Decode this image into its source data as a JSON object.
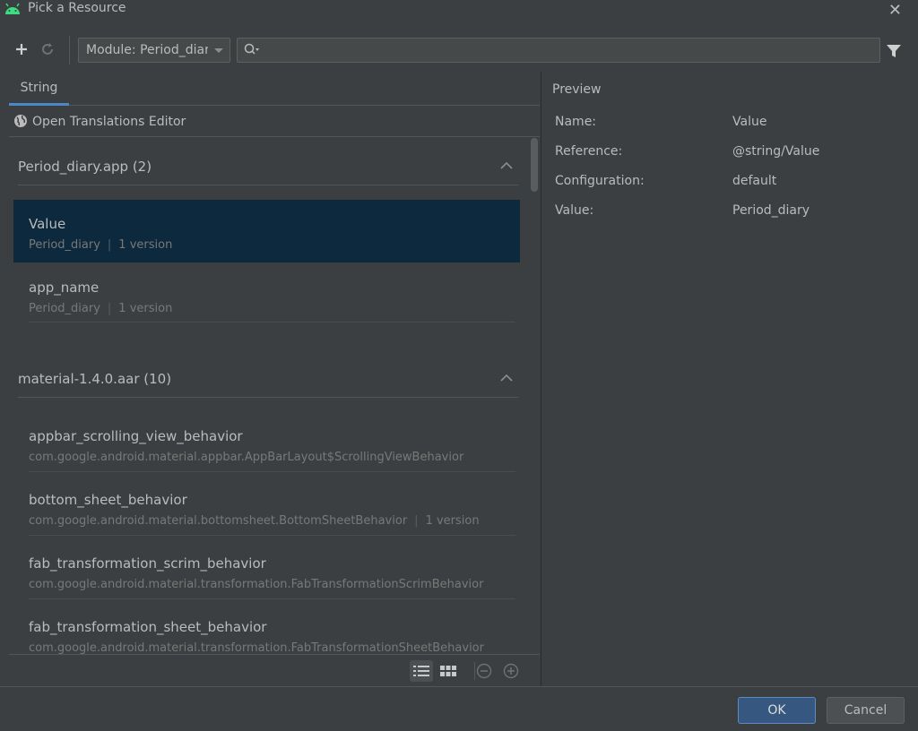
{
  "window": {
    "title": "Pick a Resource"
  },
  "toolbar": {
    "module_label": "Module: Period_diar",
    "search_value": ""
  },
  "tabs": [
    {
      "label": "String",
      "active": true
    }
  ],
  "translations_link": "Open Translations Editor",
  "sections": [
    {
      "name": "Period_diary.app (2)",
      "items": [
        {
          "name": "Value",
          "sub": "Period_diary",
          "version": "1 version",
          "selected": true
        },
        {
          "name": "app_name",
          "sub": "Period_diary",
          "version": "1 version",
          "selected": false
        }
      ]
    },
    {
      "name": "material-1.4.0.aar (10)",
      "items": [
        {
          "name": "appbar_scrolling_view_behavior",
          "sub": "com.google.android.material.appbar.AppBarLayout$ScrollingViewBehavior",
          "version": ""
        },
        {
          "name": "bottom_sheet_behavior",
          "sub": "com.google.android.material.bottomsheet.BottomSheetBehavior",
          "version": "1 version"
        },
        {
          "name": "fab_transformation_scrim_behavior",
          "sub": "com.google.android.material.transformation.FabTransformationScrimBehavior",
          "version": ""
        },
        {
          "name": "fab_transformation_sheet_behavior",
          "sub": "com.google.android.material.transformation.FabTransformationSheetBehavior",
          "version": ""
        }
      ]
    }
  ],
  "preview": {
    "title": "Preview",
    "rows": [
      {
        "key": "Name:",
        "value": "Value"
      },
      {
        "key": "Reference:",
        "value": "@string/Value"
      },
      {
        "key": "Configuration:",
        "value": "default"
      },
      {
        "key": "Value:",
        "value": "Period_diary"
      }
    ]
  },
  "buttons": {
    "ok": "OK",
    "cancel": "Cancel"
  },
  "colors": {
    "background": "#3c3f41",
    "selection": "#0d293e",
    "accent": "#4a88c7",
    "ok_button": "#365880",
    "android_green": "#3ddc84"
  },
  "icons": [
    "android-icon",
    "close-icon",
    "add-icon",
    "refresh-icon",
    "chevron-down-icon",
    "search-icon",
    "filter-icon",
    "globe-icon",
    "chevron-up-icon",
    "list-view-icon",
    "grid-view-icon",
    "zoom-out-icon",
    "zoom-in-icon"
  ]
}
